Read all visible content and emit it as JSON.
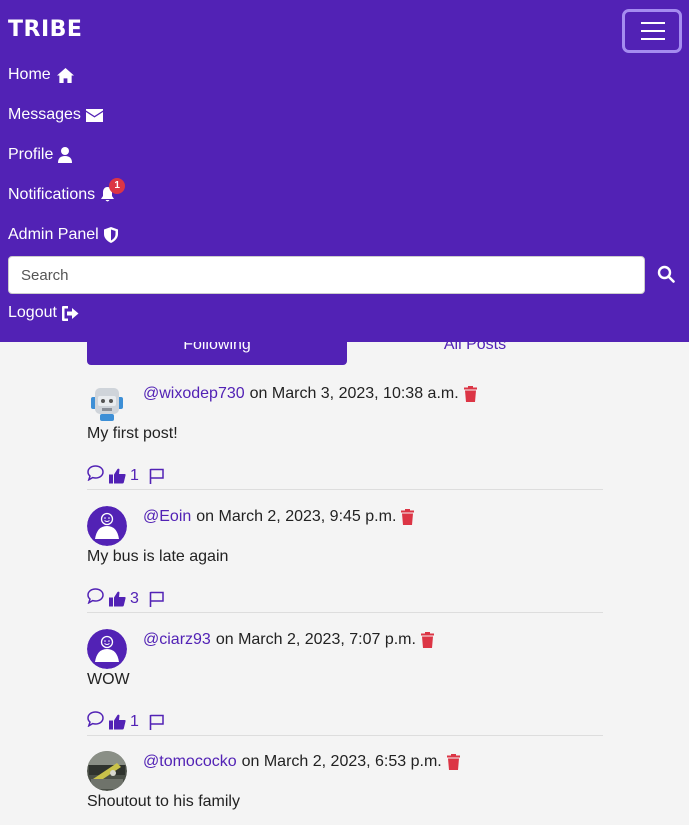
{
  "navbar": {
    "brand": "TRIBE",
    "links": {
      "home": "Home",
      "messages": "Messages",
      "profile": "Profile",
      "notifications": "Notifications",
      "admin": "Admin Panel",
      "logout": "Logout"
    },
    "notification_count": "1",
    "search_placeholder": "Search"
  },
  "tabs": {
    "following": "Following",
    "all_posts": "All Posts"
  },
  "posts": [
    {
      "handle": "@wixodep730",
      "date": "on March 3, 2023, 10:38 a.m.",
      "content": "My first post!",
      "likes": "1",
      "avatar": "robot"
    },
    {
      "handle": "@Eoin",
      "date": "on March 2, 2023, 9:45 p.m.",
      "content": "My bus is late again",
      "likes": "3",
      "avatar": "default"
    },
    {
      "handle": "@ciarz93",
      "date": "on March 2, 2023, 7:07 p.m.",
      "content": "WOW",
      "likes": "1",
      "avatar": "default"
    },
    {
      "handle": "@tomococko",
      "date": "on March 2, 2023, 6:53 p.m.",
      "content": "Shoutout to his family",
      "avatar": "photo"
    }
  ],
  "colors": {
    "brand": "#5222b5",
    "delete": "#dc3545",
    "background": "#f4f4f4"
  }
}
